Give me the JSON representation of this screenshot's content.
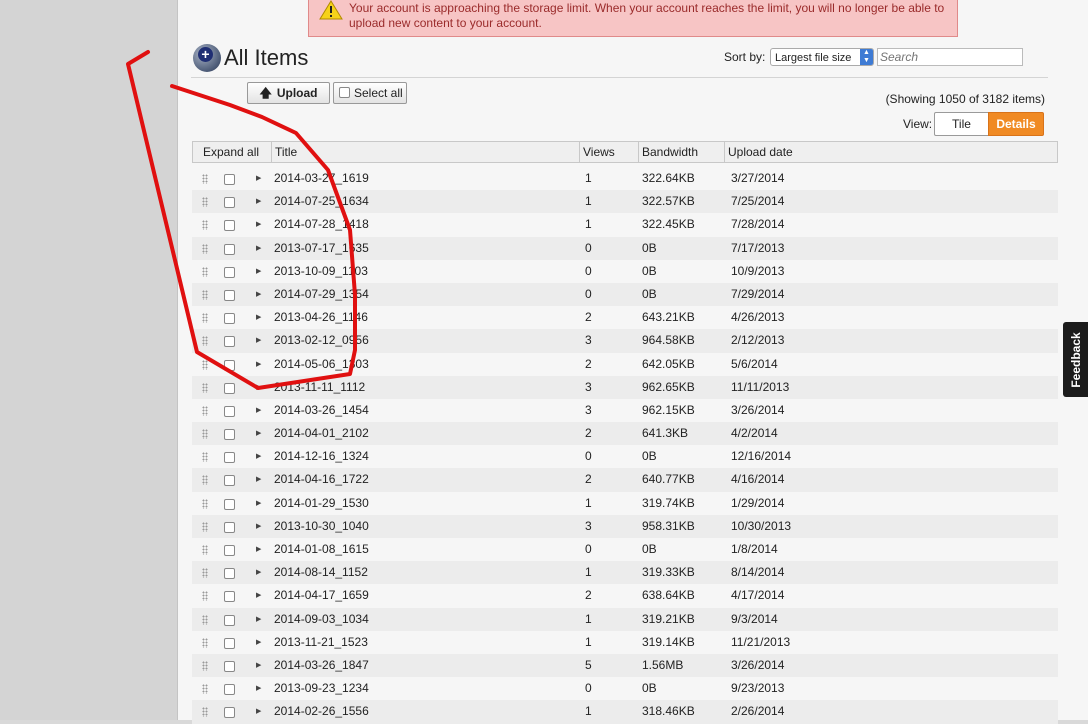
{
  "warning": {
    "text": "Your account is approaching the storage limit. When your account reaches the limit, you will no longer be able to upload new content to your account."
  },
  "header": {
    "title": "All Items",
    "sort_label": "Sort by:",
    "sort_value": "Largest file size",
    "search_placeholder": "Search"
  },
  "toolbar": {
    "upload_label": "Upload",
    "select_all_label": "Select all",
    "showing": "(Showing 1050 of 3182 items)",
    "view_label": "View:",
    "tile_label": "Tile",
    "details_label": "Details"
  },
  "table": {
    "columns": [
      "Expand all",
      "Title",
      "Views",
      "Bandwidth",
      "Upload date"
    ],
    "rows": [
      {
        "title": "2014-03-27_1619",
        "views": "1",
        "bandwidth": "322.64KB",
        "date": "3/27/2014"
      },
      {
        "title": "2014-07-25_1634",
        "views": "1",
        "bandwidth": "322.57KB",
        "date": "7/25/2014"
      },
      {
        "title": "2014-07-28_1418",
        "views": "1",
        "bandwidth": "322.45KB",
        "date": "7/28/2014"
      },
      {
        "title": "2013-07-17_1635",
        "views": "0",
        "bandwidth": "0B",
        "date": "7/17/2013"
      },
      {
        "title": "2013-10-09_1103",
        "views": "0",
        "bandwidth": "0B",
        "date": "10/9/2013"
      },
      {
        "title": "2014-07-29_1354",
        "views": "0",
        "bandwidth": "0B",
        "date": "7/29/2014"
      },
      {
        "title": "2013-04-26_1146",
        "views": "2",
        "bandwidth": "643.21KB",
        "date": "4/26/2013"
      },
      {
        "title": "2013-02-12_0956",
        "views": "3",
        "bandwidth": "964.58KB",
        "date": "2/12/2013"
      },
      {
        "title": "2014-05-06_1303",
        "views": "2",
        "bandwidth": "642.05KB",
        "date": "5/6/2014"
      },
      {
        "title": "2013-11-11_1112",
        "views": "3",
        "bandwidth": "962.65KB",
        "date": "11/11/2013"
      },
      {
        "title": "2014-03-26_1454",
        "views": "3",
        "bandwidth": "962.15KB",
        "date": "3/26/2014"
      },
      {
        "title": "2014-04-01_2102",
        "views": "2",
        "bandwidth": "641.3KB",
        "date": "4/2/2014"
      },
      {
        "title": "2014-12-16_1324",
        "views": "0",
        "bandwidth": "0B",
        "date": "12/16/2014"
      },
      {
        "title": "2014-04-16_1722",
        "views": "2",
        "bandwidth": "640.77KB",
        "date": "4/16/2014"
      },
      {
        "title": "2014-01-29_1530",
        "views": "1",
        "bandwidth": "319.74KB",
        "date": "1/29/2014"
      },
      {
        "title": "2013-10-30_1040",
        "views": "3",
        "bandwidth": "958.31KB",
        "date": "10/30/2013"
      },
      {
        "title": "2014-01-08_1615",
        "views": "0",
        "bandwidth": "0B",
        "date": "1/8/2014"
      },
      {
        "title": "2014-08-14_1152",
        "views": "1",
        "bandwidth": "319.33KB",
        "date": "8/14/2014"
      },
      {
        "title": "2014-04-17_1659",
        "views": "2",
        "bandwidth": "638.64KB",
        "date": "4/17/2014"
      },
      {
        "title": "2014-09-03_1034",
        "views": "1",
        "bandwidth": "319.21KB",
        "date": "9/3/2014"
      },
      {
        "title": "2013-11-21_1523",
        "views": "1",
        "bandwidth": "319.14KB",
        "date": "11/21/2013"
      },
      {
        "title": "2014-03-26_1847",
        "views": "5",
        "bandwidth": "1.56MB",
        "date": "3/26/2014"
      },
      {
        "title": "2013-09-23_1234",
        "views": "0",
        "bandwidth": "0B",
        "date": "9/23/2013"
      },
      {
        "title": "2014-02-26_1556",
        "views": "1",
        "bandwidth": "318.46KB",
        "date": "2/26/2014"
      }
    ]
  },
  "feedback_label": "Feedback",
  "colors": {
    "warning_bg": "#f7c5c5",
    "details_active": "#f08a24",
    "annotation": "#e01010"
  },
  "icons": [
    "warning-icon",
    "upload-arrow-icon",
    "expand-arrow-icon",
    "drag-handle-icon",
    "items-globe-icon"
  ]
}
